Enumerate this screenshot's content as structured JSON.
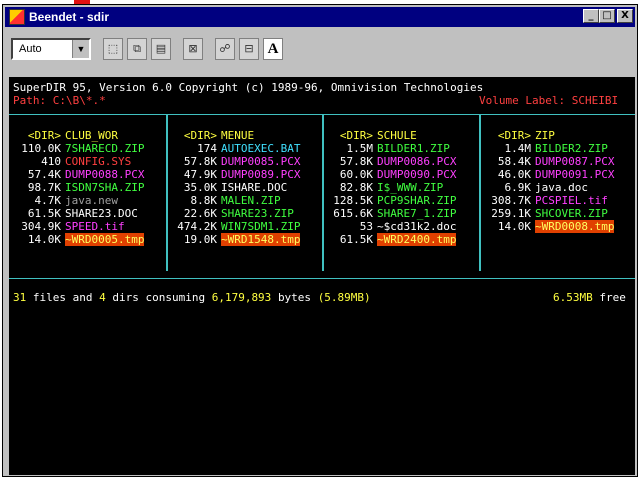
{
  "window": {
    "title": "Beendet - sdir",
    "controls": [
      "_",
      "□",
      "X"
    ]
  },
  "toolbar": {
    "font_size": "Auto"
  },
  "console": {
    "header_line": "SuperDIR 95, Version 6.0 Copyright (c) 1989-96, Omnivision Technologies",
    "path_label": "Path: C:\\B\\*.*",
    "volume_label": "Volume Label: SCHEIBI",
    "columns": [
      {
        "dir_tag": "<DIR>",
        "dir_name": "CLUB_WOR",
        "entries": [
          {
            "size": "110.0K",
            "name": "7SHARECD.ZIP"
          },
          {
            "size": "410",
            "name": "CONFIG.SYS"
          },
          {
            "size": "57.4K",
            "name": "DUMP0088.PCX"
          },
          {
            "size": "98.7K",
            "name": "ISDN7SHA.ZIP"
          },
          {
            "size": "4.7K",
            "name": "java.new"
          },
          {
            "size": "61.5K",
            "name": "SHARE23.DOC"
          },
          {
            "size": "304.9K",
            "name": "SPEED.tif"
          },
          {
            "size": "14.0K",
            "name": "~WRD0005.tmp"
          }
        ]
      },
      {
        "dir_tag": "<DIR>",
        "dir_name": "MENUE",
        "entries": [
          {
            "size": "174",
            "name": "AUTOEXEC.BAT"
          },
          {
            "size": "57.8K",
            "name": "DUMP0085.PCX"
          },
          {
            "size": "47.9K",
            "name": "DUMP0089.PCX"
          },
          {
            "size": "35.0K",
            "name": "ISHARE.DOC"
          },
          {
            "size": "8.8K",
            "name": "MALEN.ZIP"
          },
          {
            "size": "22.6K",
            "name": "SHARE23.ZIP"
          },
          {
            "size": "474.2K",
            "name": "WIN7SDM1.ZIP"
          },
          {
            "size": "19.0K",
            "name": "~WRD1548.tmp"
          }
        ]
      },
      {
        "dir_tag": "<DIR>",
        "dir_name": "SCHULE",
        "entries": [
          {
            "size": "1.5M",
            "name": "BILDER1.ZIP"
          },
          {
            "size": "57.8K",
            "name": "DUMP0086.PCX"
          },
          {
            "size": "60.0K",
            "name": "DUMP0090.PCX"
          },
          {
            "size": "82.8K",
            "name": "I$_WWW.ZIP"
          },
          {
            "size": "128.5K",
            "name": "PCP9SHAR.ZIP"
          },
          {
            "size": "615.6K",
            "name": "SHARE7_1.ZIP"
          },
          {
            "size": "53",
            "name": "~$cd31k2.doc"
          },
          {
            "size": "61.5K",
            "name": "~WRD2400.tmp"
          }
        ]
      },
      {
        "dir_tag": "<DIR>",
        "dir_name": "ZIP",
        "entries": [
          {
            "size": "1.4M",
            "name": "BILDER2.ZIP"
          },
          {
            "size": "58.4K",
            "name": "DUMP0087.PCX"
          },
          {
            "size": "46.0K",
            "name": "DUMP0091.PCX"
          },
          {
            "size": "6.9K",
            "name": "java.doc"
          },
          {
            "size": "308.7K",
            "name": "PCSPIEL.tif"
          },
          {
            "size": "259.1K",
            "name": "SHCOVER.ZIP"
          },
          {
            "size": "14.0K",
            "name": "~WRD0008.tmp"
          }
        ]
      }
    ],
    "summary": {
      "files": "31",
      "files_text": "files and",
      "dirs": "4",
      "dirs_text": "dirs consuming",
      "bytes": "6,179,893",
      "bytes_text": "bytes",
      "mb": "(5.89MB)",
      "free_value": "6.53MB",
      "free_text": "free"
    }
  },
  "colors": {
    "console_bg": "#000000",
    "titlebar": "#000080",
    "divider": "#40c0c0",
    "highlight_bg": "#e04000"
  }
}
